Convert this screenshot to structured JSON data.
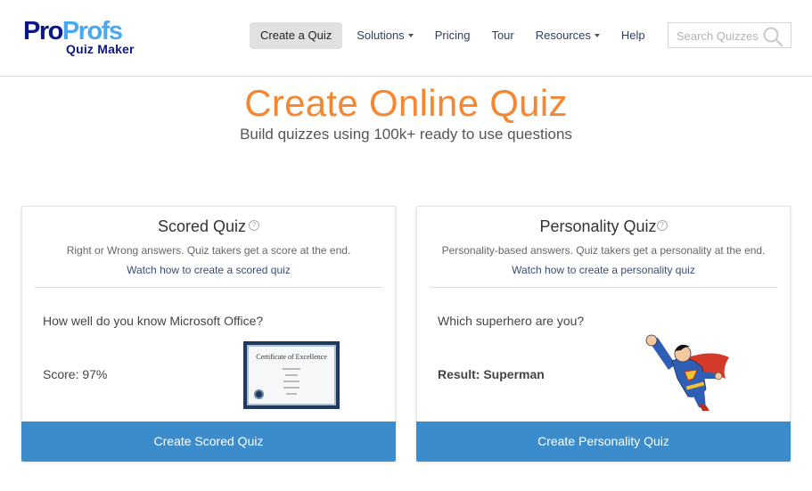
{
  "brand": {
    "logo_pro": "Pro",
    "logo_profs": "Profs",
    "logo_product": "Quiz Maker",
    "colors": {
      "navy": "#0d1687",
      "light_blue": "#4aa8ee",
      "accent_orange": "#f58733",
      "button_blue": "#3c8bcb"
    }
  },
  "nav": {
    "items": [
      {
        "label": "Create a Quiz",
        "active": true,
        "dropdown": false
      },
      {
        "label": "Solutions",
        "active": false,
        "dropdown": true
      },
      {
        "label": "Pricing",
        "active": false,
        "dropdown": false
      },
      {
        "label": "Tour",
        "active": false,
        "dropdown": false
      },
      {
        "label": "Resources",
        "active": false,
        "dropdown": true
      },
      {
        "label": "Help",
        "active": false,
        "dropdown": false
      }
    ],
    "search_placeholder": "Search Quizzes",
    "search_icon": "search-icon"
  },
  "hero": {
    "title": "Create Online Quiz",
    "subtitle": "Build quizzes using 100k+ ready to use questions"
  },
  "cards": [
    {
      "title": "Scored Quiz",
      "help_glyph": "?",
      "description": "Right or Wrong answers. Quiz takers get a score at the end.",
      "link": "Watch how to create a scored quiz",
      "example_question": "How well do you know Microsoft Office?",
      "example_result": "Score: 97%",
      "image": "certificate-image",
      "certificate_title": "Certificate of Excellence",
      "button": "Create Scored Quiz"
    },
    {
      "title": "Personality Quiz",
      "help_glyph": "?",
      "description": "Personality-based answers. Quiz takers get a personality at the end.",
      "link": "Watch how to create a personality quiz",
      "example_question": "Which superhero are you?",
      "example_result": "Result: Superman",
      "image": "superhero-image",
      "button": "Create Personality Quiz"
    }
  ]
}
